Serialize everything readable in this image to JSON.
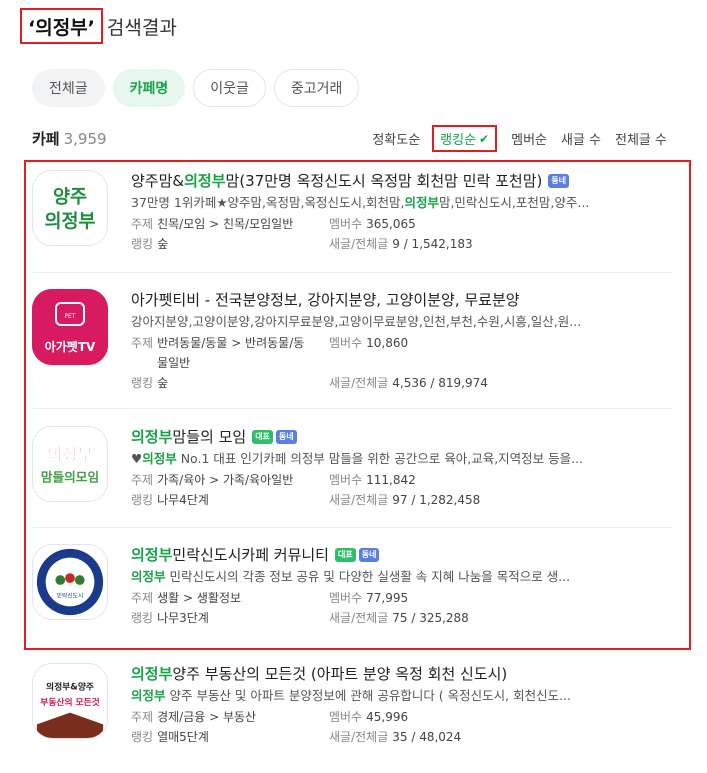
{
  "search": {
    "query": "‘의정부’",
    "suffix": "검색결과"
  },
  "chips": [
    "전체글",
    "카페명",
    "이웃글",
    "중고거래"
  ],
  "result_label": "카페",
  "result_count": "3,959",
  "sorts": [
    "정확도순",
    "랭킹순",
    "멤버순",
    "새글 수",
    "전체글 수"
  ],
  "labels": {
    "topic": "주제",
    "members": "멤버수",
    "ranking": "랭킹",
    "posts": "새글/전체글"
  },
  "cafes": [
    {
      "name_pre": "양주맘&",
      "name_hl": "의정부",
      "name_post": "맘(37만명 옥정신도시 옥정맘 회천맘 민락 포천맘)",
      "badges": [
        "동네"
      ],
      "desc_pre": "37만명 1위카페★양주맘,옥정맘,옥정신도시,회천맘,",
      "desc_hl": "의정부",
      "desc_post": "맘,민락신도시,포천맘,양주...",
      "topic": "친목/모임 > 친목/모임일반",
      "members": "365,065",
      "ranking": "숲",
      "posts": "9 / 1,542,183",
      "thumb_lines": [
        "양주",
        "의정부"
      ]
    },
    {
      "name_pre": "아가펫티비 - 전국분양정보, 강아지분양, 고양이분양, 무료분양",
      "name_hl": "",
      "name_post": "",
      "badges": [],
      "desc_pre": "강아지분양,고양이분양,강아지무료분양,고양이무료분양,인천,부천,수원,시흥,일산,원...",
      "desc_hl": "",
      "desc_post": "",
      "topic": "반려동물/동물 > 반려동물/동물일반",
      "members": "10,860",
      "ranking": "숲",
      "posts": "4,536 / 819,974",
      "thumb_lines": [
        "PET",
        "아가펫TV"
      ]
    },
    {
      "name_pre": "",
      "name_hl": "의정부",
      "name_post": " 맘들의 모임",
      "badges": [
        "대표",
        "동네"
      ],
      "desc_pre": "♥",
      "desc_hl": "의정부",
      "desc_post": " No.1 대표 인기카페 의정부 맘들을 위한 공간으로 육아,교육,지역정보 등을...",
      "topic": "가족/육아 > 가족/육아일반",
      "members": "111,842",
      "ranking": "나무4단계",
      "posts": "97 / 1,282,458",
      "thumb_lines": [
        "의정부",
        "맘들의모임"
      ]
    },
    {
      "name_pre": "",
      "name_hl": "의정부",
      "name_post": " 민락신도시카페 커뮤니티",
      "badges": [
        "대표",
        "동네"
      ],
      "desc_pre": "",
      "desc_hl": "의정부",
      "desc_post": " 민락신도시의 각종 정보 공유 및 다양한 실생활 속 지혜 나눔을 목적으로 생...",
      "topic": "생활 > 생활정보",
      "members": "77,995",
      "ranking": "나무3단계",
      "posts": "75 / 325,288",
      "thumb_lines": [
        "민락신도시"
      ]
    },
    {
      "name_pre": "",
      "name_hl": "의정부",
      "name_post": " 양주 부동산의 모든것 (아파트 분양 옥정 회천 신도시)",
      "badges": [],
      "desc_pre": "",
      "desc_hl": "의정부",
      "desc_post": " 양주 부동산 및 아파트 분양정보에 관해 공유합니다 ( 옥정신도시, 회천신도...",
      "topic": "경제/금융 > 부동산",
      "members": "45,996",
      "ranking": "열매5단계",
      "posts": "35 / 48,024",
      "thumb_lines": [
        "의정부&양주",
        "부동산의 모든것"
      ]
    }
  ]
}
